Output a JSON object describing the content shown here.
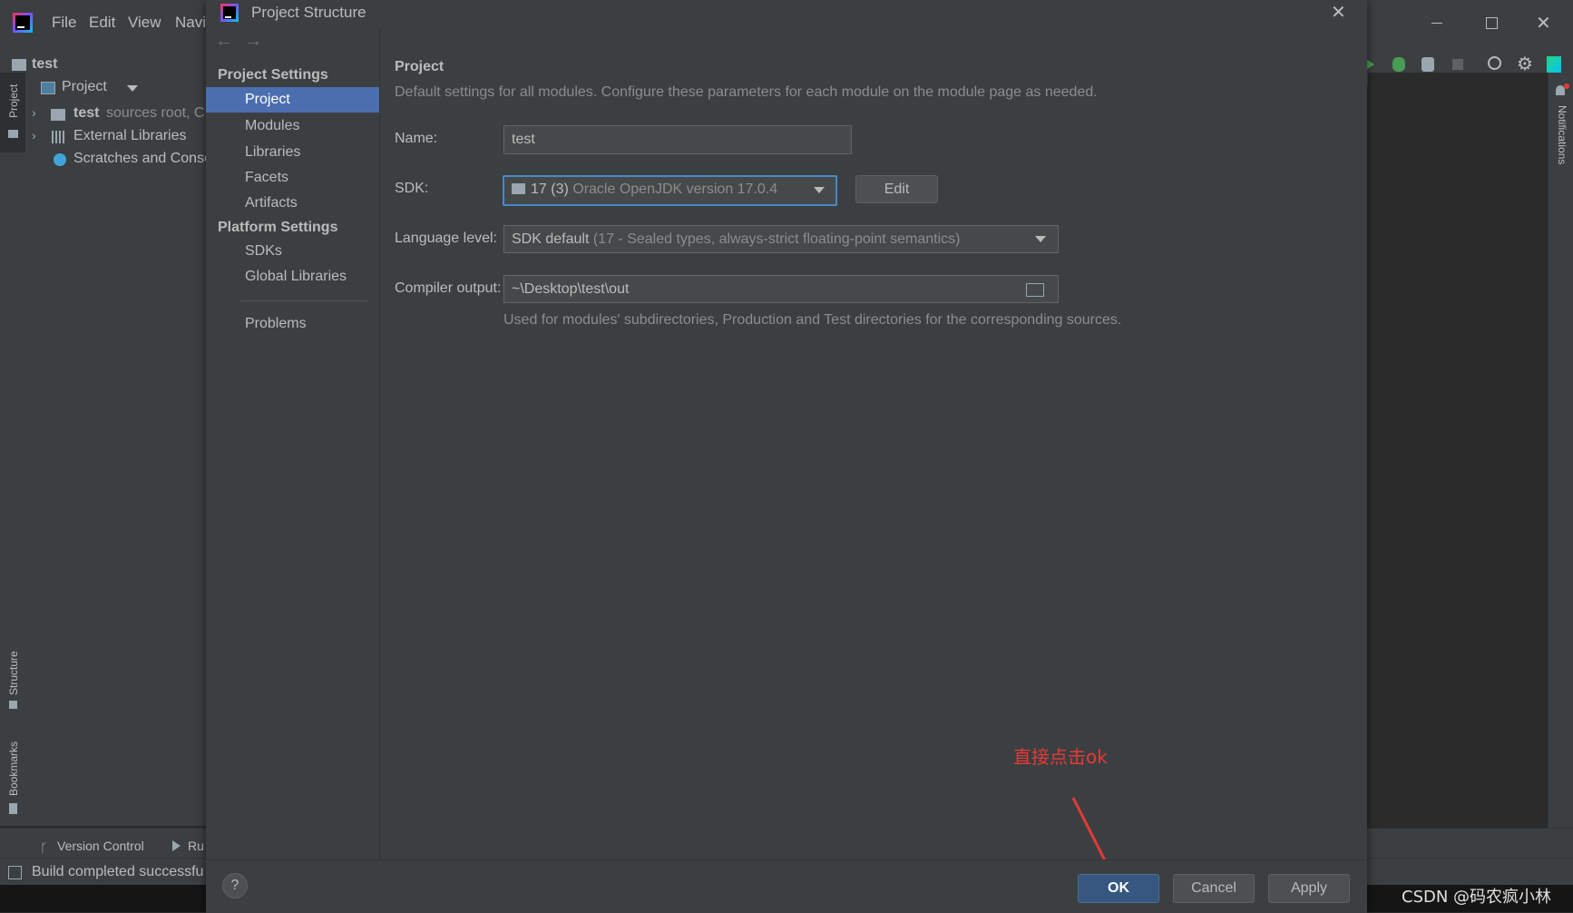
{
  "ide": {
    "menu": [
      "File",
      "Edit",
      "View",
      "Navi"
    ],
    "project_name": "test",
    "project_view_label": "Project",
    "tree": [
      {
        "name": "test",
        "note": "sources root, C"
      },
      {
        "name": "External Libraries"
      },
      {
        "name": "Scratches and Conso"
      }
    ],
    "left_stripe": {
      "project": "Project",
      "structure": "Structure",
      "bookmarks": "Bookmarks"
    },
    "right_stripe": {
      "notifications": "Notifications"
    },
    "bottom_tools": {
      "version_control": "Version Control",
      "run": "Ru"
    },
    "status_text": "Build completed successfu"
  },
  "dialog": {
    "title": "Project Structure",
    "sidebar": {
      "project_settings_header": "Project Settings",
      "project_settings_items": [
        "Project",
        "Modules",
        "Libraries",
        "Facets",
        "Artifacts"
      ],
      "platform_settings_header": "Platform Settings",
      "platform_settings_items": [
        "SDKs",
        "Global Libraries"
      ],
      "problems": "Problems",
      "selected": "Project"
    },
    "main": {
      "heading": "Project",
      "description": "Default settings for all modules. Configure these parameters for each module on the module page as needed.",
      "name_label": "Name:",
      "name_value": "test",
      "sdk_label": "SDK:",
      "sdk_value_main": "17 (3)",
      "sdk_value_detail": "Oracle OpenJDK version 17.0.4",
      "edit_button": "Edit",
      "language_label": "Language level:",
      "language_value_main": "SDK default",
      "language_value_detail": "(17 - Sealed types, always-strict floating-point semantics)",
      "compiler_label": "Compiler output:",
      "compiler_value": "~\\Desktop\\test\\out",
      "compiler_hint": "Used for modules' subdirectories, Production and Test directories for the corresponding sources."
    },
    "footer": {
      "ok": "OK",
      "cancel": "Cancel",
      "apply": "Apply",
      "help": "?"
    }
  },
  "annotation": {
    "text": "直接点击ok",
    "color": "#e53935"
  },
  "watermark": "CSDN @码农疯小林",
  "colors": {
    "selection": "#4b6eaf",
    "default_button": "#365880",
    "panel": "#3c3f41"
  }
}
